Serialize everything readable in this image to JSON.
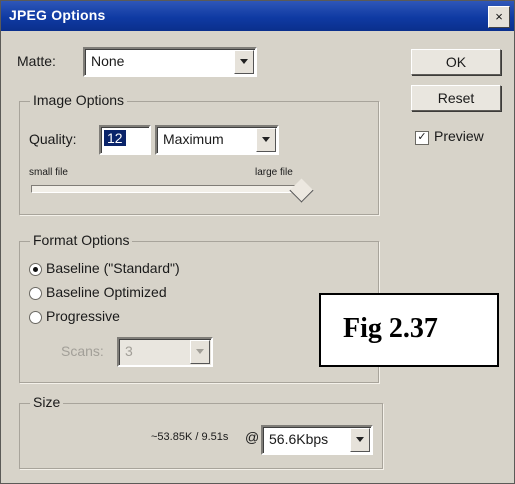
{
  "window": {
    "title": "JPEG Options",
    "close_glyph": "×"
  },
  "matte": {
    "label": "Matte:",
    "value": "None"
  },
  "image_options": {
    "group_label": "Image Options",
    "quality_label": "Quality:",
    "quality_value": "12",
    "quality_preset": "Maximum",
    "slider_min_label": "small file",
    "slider_max_label": "large file",
    "slider_level": 1.0
  },
  "format_options": {
    "group_label": "Format Options",
    "options": [
      {
        "label": "Baseline (\"Standard\")",
        "selected": true
      },
      {
        "label": "Baseline Optimized",
        "selected": false
      },
      {
        "label": "Progressive",
        "selected": false
      }
    ],
    "scans_label": "Scans:",
    "scans_value": "3"
  },
  "size": {
    "group_label": "Size",
    "estimate": "~53.85K / 9.51s",
    "at_label": "@",
    "speed": "56.6Kbps"
  },
  "buttons": {
    "ok": "OK",
    "reset": "Reset",
    "preview_label": "Preview",
    "preview_checked_glyph": "✓"
  },
  "caption": "Fig 2.37",
  "colors": {
    "title_bar": "#0f3aa3",
    "dialog_bg": "#d7d3c9",
    "selection": "#0a246a"
  }
}
